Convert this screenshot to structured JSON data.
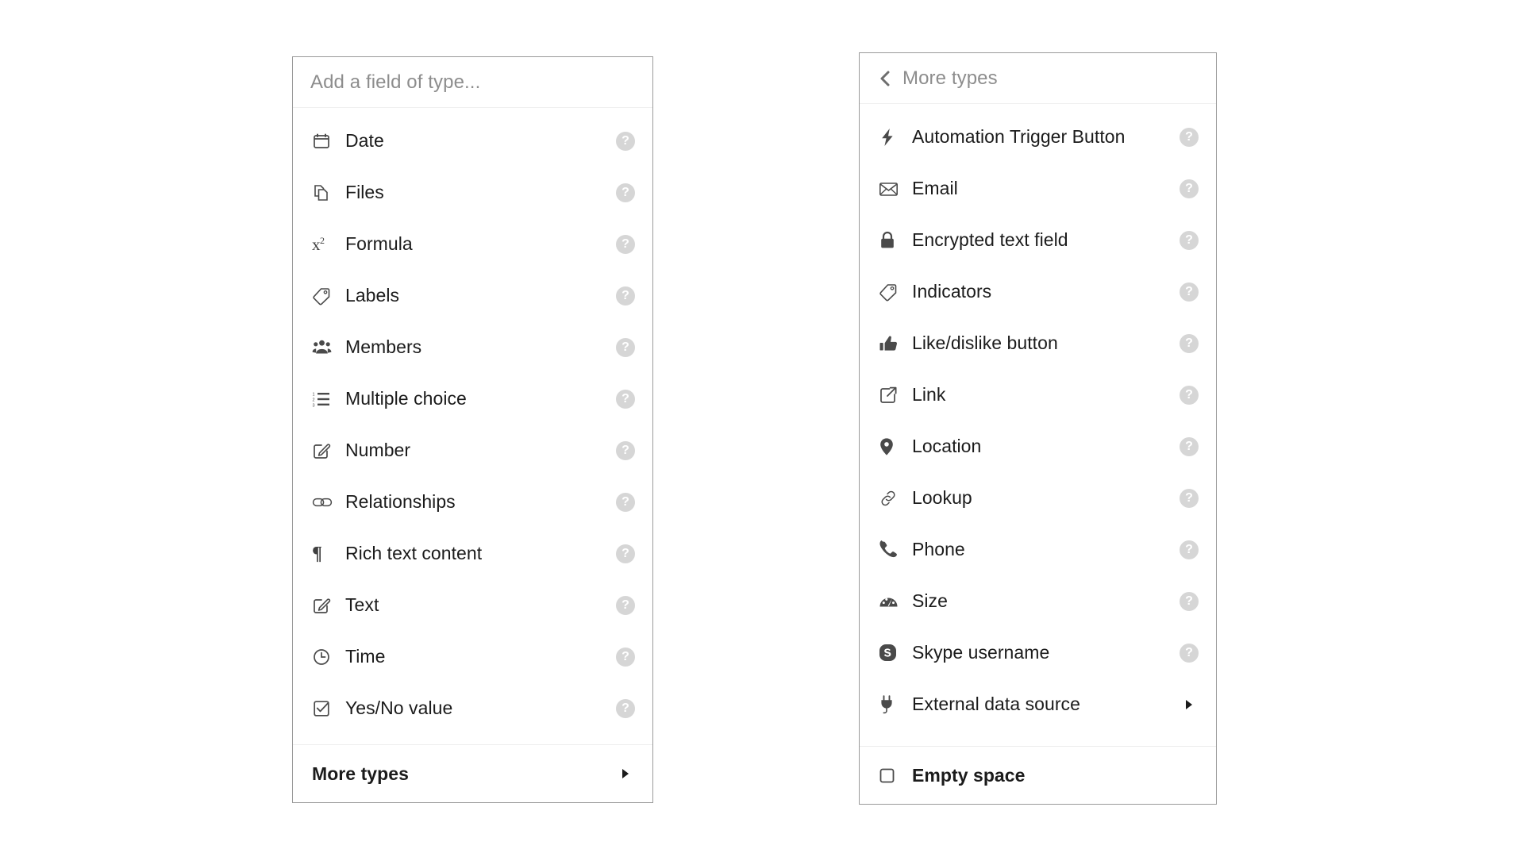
{
  "left_panel": {
    "header_placeholder": "Add a field of type...",
    "items": [
      {
        "label": "Date",
        "icon": "calendar-icon",
        "help": true
      },
      {
        "label": "Files",
        "icon": "files-icon",
        "help": true
      },
      {
        "label": "Formula",
        "icon": "x-squared-icon",
        "help": true
      },
      {
        "label": "Labels",
        "icon": "tag-icon",
        "help": true
      },
      {
        "label": "Members",
        "icon": "people-group-icon",
        "help": true
      },
      {
        "label": "Multiple choice",
        "icon": "numbered-list-icon",
        "help": true
      },
      {
        "label": "Number",
        "icon": "pencil-square-icon",
        "help": true
      },
      {
        "label": "Relationships",
        "icon": "chain-link-icon",
        "help": true
      },
      {
        "label": "Rich text content",
        "icon": "pilcrow-icon",
        "help": true
      },
      {
        "label": "Text",
        "icon": "pencil-square-icon",
        "help": true
      },
      {
        "label": "Time",
        "icon": "clock-icon",
        "help": true
      },
      {
        "label": "Yes/No value",
        "icon": "checkbox-checked-icon",
        "help": true
      }
    ],
    "footer": {
      "label": "More types",
      "arrow": "triangle-right-icon"
    }
  },
  "right_panel": {
    "header_title": "More types",
    "back_icon": "chevron-left-icon",
    "items": [
      {
        "label": "Automation Trigger Button",
        "icon": "lightning-bolt-icon",
        "help": true
      },
      {
        "label": "Email",
        "icon": "envelope-icon",
        "help": true
      },
      {
        "label": "Encrypted text field",
        "icon": "lock-icon",
        "help": true
      },
      {
        "label": "Indicators",
        "icon": "tag-icon",
        "help": true
      },
      {
        "label": "Like/dislike button",
        "icon": "thumbs-up-icon",
        "help": true
      },
      {
        "label": "Link",
        "icon": "external-link-icon",
        "help": true
      },
      {
        "label": "Location",
        "icon": "map-pin-icon",
        "help": true
      },
      {
        "label": "Lookup",
        "icon": "link-chain-icon",
        "help": true
      },
      {
        "label": "Phone",
        "icon": "phone-icon",
        "help": true
      },
      {
        "label": "Size",
        "icon": "gauge-icon",
        "help": true
      },
      {
        "label": "Skype username",
        "icon": "skype-icon",
        "help": true
      },
      {
        "label": "External data source",
        "icon": "plug-icon",
        "help": false,
        "arrow": "triangle-right-icon"
      }
    ],
    "footer": {
      "label": "Empty space",
      "icon": "empty-square-icon"
    }
  },
  "glyphs": {
    "help": "?"
  },
  "colors": {
    "panel_border": "#9a9a9a",
    "divider": "#f0f0f0",
    "label_text": "#1b1b1b",
    "header_text": "#8d8d8d",
    "help_badge_bg": "#d6d6d6",
    "icon": "#4a4a4a",
    "background": "#ffffff"
  }
}
